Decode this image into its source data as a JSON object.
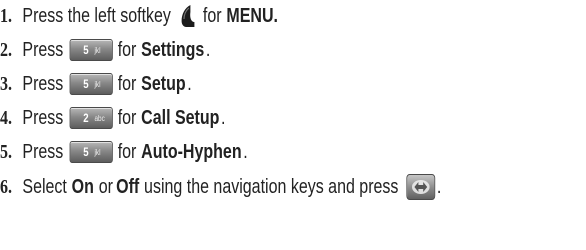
{
  "steps": [
    {
      "number": "1.",
      "prefix": "Press the left softkey",
      "icon": "left-softkey-icon",
      "middle": "for",
      "bold": "MENU.",
      "suffix": ""
    },
    {
      "number": "2.",
      "prefix": "Press",
      "key": {
        "digit": "5",
        "letters": "jkl"
      },
      "middle": "for",
      "bold": "Settings",
      "suffix": "."
    },
    {
      "number": "3.",
      "prefix": "Press",
      "key": {
        "digit": "5",
        "letters": "jkl"
      },
      "middle": "for",
      "bold": "Setup",
      "suffix": "."
    },
    {
      "number": "4.",
      "prefix": "Press",
      "key": {
        "digit": "2",
        "letters": "abc"
      },
      "middle": "for",
      "bold": "Call Setup",
      "suffix": "."
    },
    {
      "number": "5.",
      "prefix": "Press",
      "key": {
        "digit": "5",
        "letters": "jkl"
      },
      "middle": "for",
      "bold": "Auto-Hyphen",
      "suffix": "."
    },
    {
      "number": "6.",
      "prefix": "Select",
      "bold_on": "On",
      "or_text": "or",
      "bold_off": "Off",
      "rest": "using the navigation keys and press",
      "icon": "ok-key-icon",
      "suffix": "."
    }
  ]
}
